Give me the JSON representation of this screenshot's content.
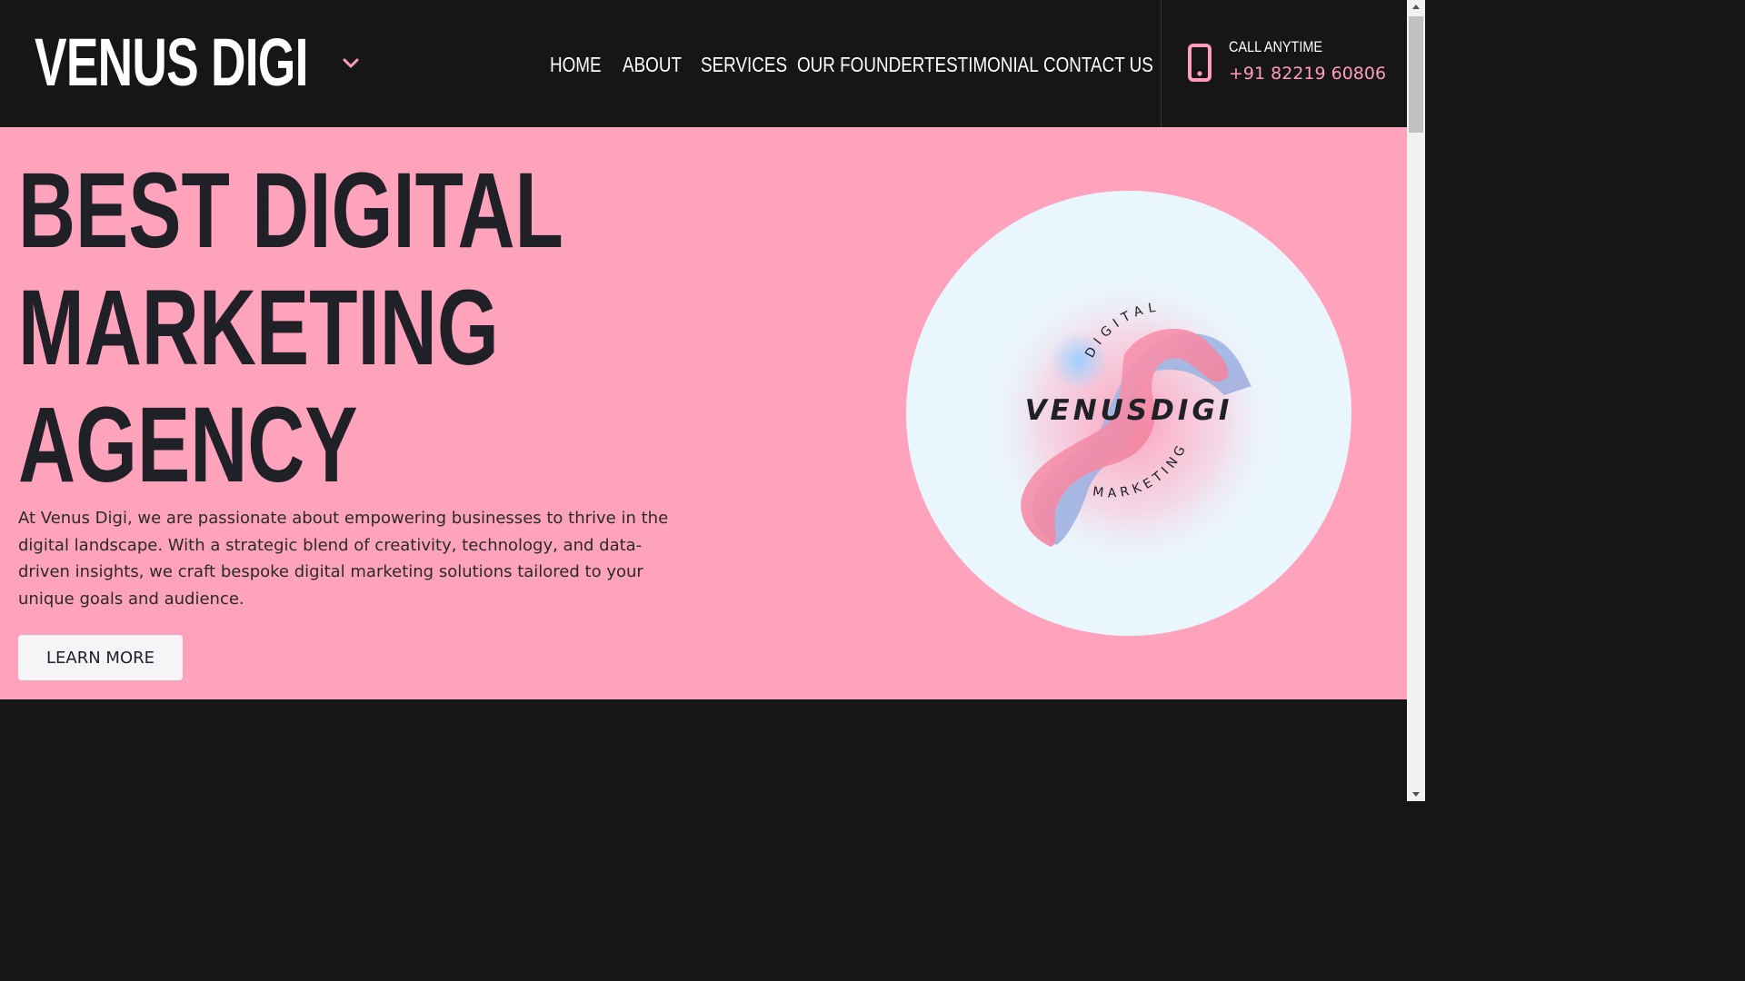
{
  "brand": {
    "name": "VENUS DIGI"
  },
  "nav": {
    "items": [
      {
        "label": "HOME"
      },
      {
        "label": "ABOUT"
      },
      {
        "label": "SERVICES"
      },
      {
        "label": "OUR FOUNDER"
      },
      {
        "label": "TESTIMONIAL"
      },
      {
        "label": "CONTACT US"
      }
    ]
  },
  "call": {
    "label": "CALL ANYTIME",
    "number": "+91 82219 60806",
    "icon": "mobile-phone-icon"
  },
  "hero": {
    "title_lines": [
      "BEST DIGITAL",
      "MARKETING",
      "AGENCY"
    ],
    "description": "At Venus Digi, we are passionate about empowering businesses to thrive in the digital landscape. With a strategic blend of creativity, technology, and data-driven insights, we craft bespoke digital marketing solutions tailored to your unique goals and audience.",
    "button_label": "LEARN MORE",
    "logo": {
      "wordmark": "VENUSDIGI",
      "top_arc": "DIGITAL",
      "bottom_arc": "MARKETING"
    }
  },
  "colors": {
    "header_bg": "#161616",
    "hero_bg": "#ffa3bd",
    "accent_pink": "#ff9bbb",
    "title_dark": "#202027",
    "circle_bg": "#eaf6fd"
  }
}
